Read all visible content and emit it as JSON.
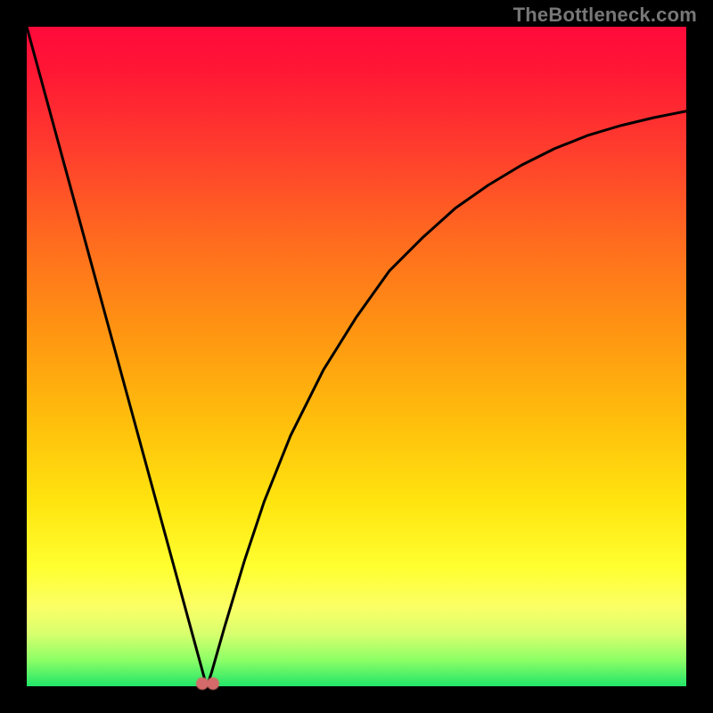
{
  "watermark": "TheBottleneck.com",
  "chart_data": {
    "type": "line",
    "title": "",
    "xlabel": "",
    "ylabel": "",
    "xlim": [
      0,
      100
    ],
    "ylim": [
      0,
      100
    ],
    "grid": false,
    "series": [
      {
        "name": "curve",
        "x": [
          0,
          3,
          6,
          9,
          12,
          15,
          18,
          21,
          24,
          27,
          27.2,
          27.5,
          28,
          30,
          33,
          36,
          40,
          45,
          50,
          55,
          60,
          65,
          70,
          75,
          80,
          85,
          90,
          95,
          100
        ],
        "y": [
          100,
          89,
          78,
          67,
          56,
          45,
          34,
          23,
          12,
          1,
          0.2,
          0.5,
          2,
          9,
          19,
          28,
          38,
          48,
          56,
          63,
          68,
          72.5,
          76,
          79,
          81.5,
          83.5,
          85,
          86.2,
          87.2
        ]
      }
    ],
    "markers": [
      {
        "name": "minimum-dot-a",
        "x": 26.6,
        "y": 0.4,
        "color": "#d46a6a"
      },
      {
        "name": "minimum-dot-b",
        "x": 28.2,
        "y": 0.4,
        "color": "#d46a6a"
      }
    ],
    "background_gradient": {
      "top": "#ff0a3b",
      "mid_upper": "#ff9412",
      "mid_lower": "#ffe40f",
      "bottom": "#22e569"
    }
  }
}
